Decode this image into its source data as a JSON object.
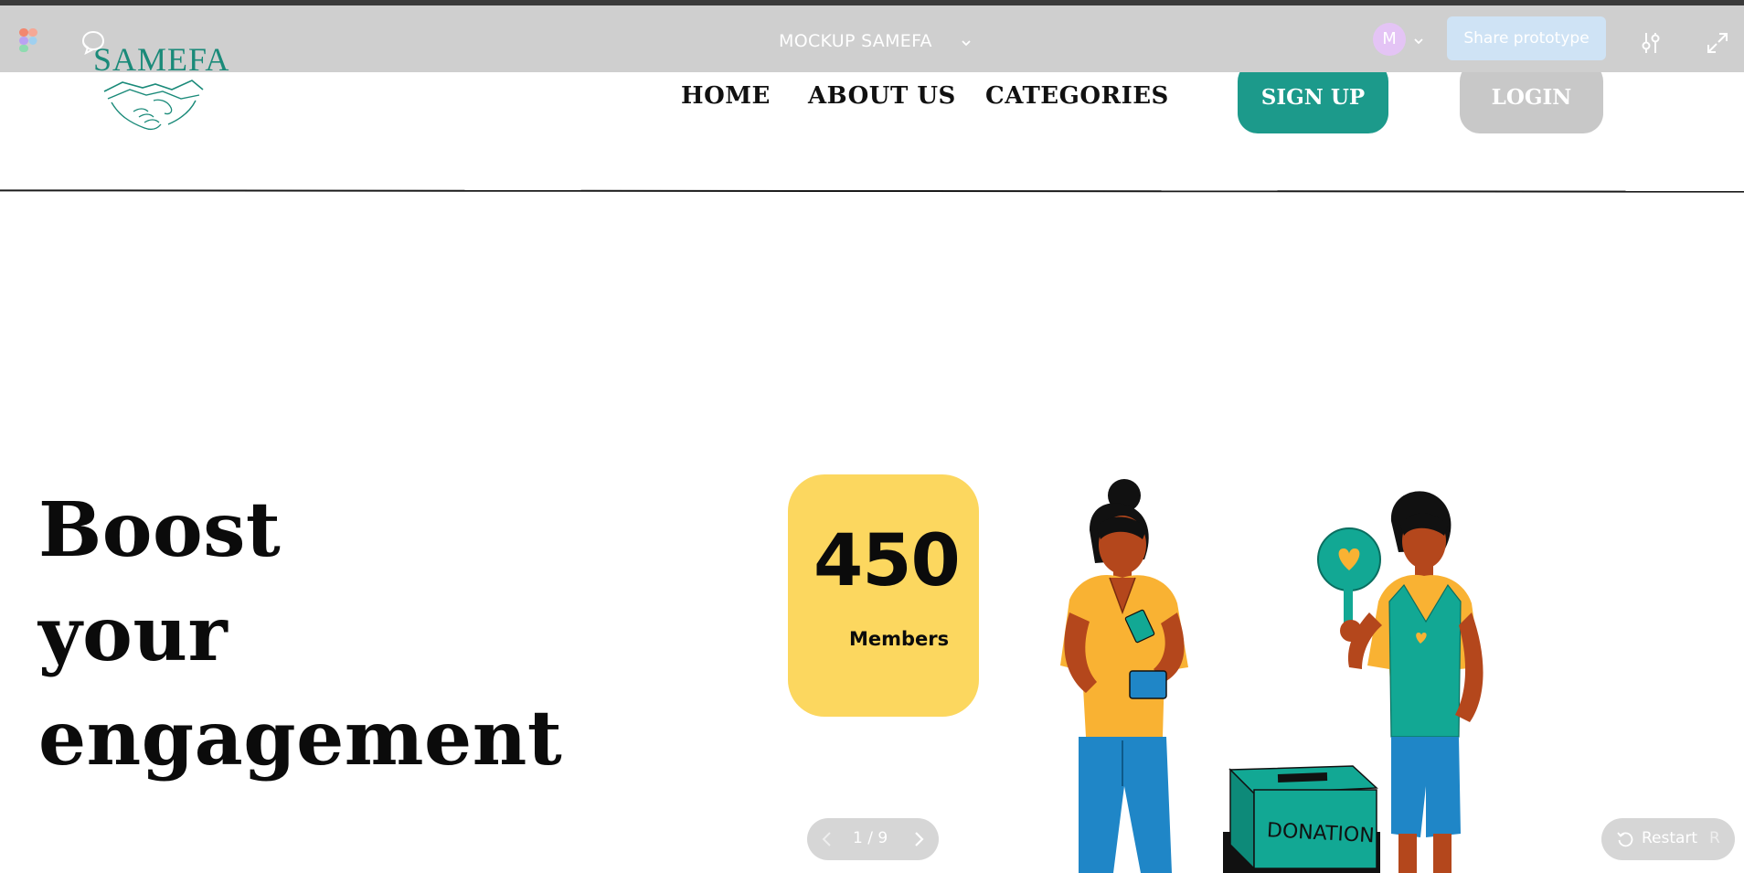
{
  "toolbar": {
    "title": "MOCKUP SAMEFA",
    "avatar_initial": "M",
    "share_label": "Share prototype",
    "icons": [
      "figma-logo",
      "comment-icon",
      "chevron-down-icon",
      "settings-sliders-icon",
      "expand-icon"
    ]
  },
  "site": {
    "logo_text": "SAMEFA",
    "nav": {
      "home": "HOME",
      "about": "ABOUT US",
      "categories": "CATEGORIES"
    },
    "signup_label": "SIGN UP",
    "login_label": "LOGIN",
    "colors": {
      "brand_teal": "#1c9a8b",
      "login_gray": "#c8c8c8",
      "card_yellow": "#fcd75f"
    }
  },
  "hero": {
    "line1": "Boost",
    "line2": "your",
    "line3": "engagement"
  },
  "stat": {
    "number": "450",
    "label": "Members"
  },
  "illustration": {
    "box_label": "DONATION"
  },
  "prototype_controls": {
    "page_indicator": "1 / 9",
    "restart_label": "Restart",
    "restart_key": "R"
  }
}
